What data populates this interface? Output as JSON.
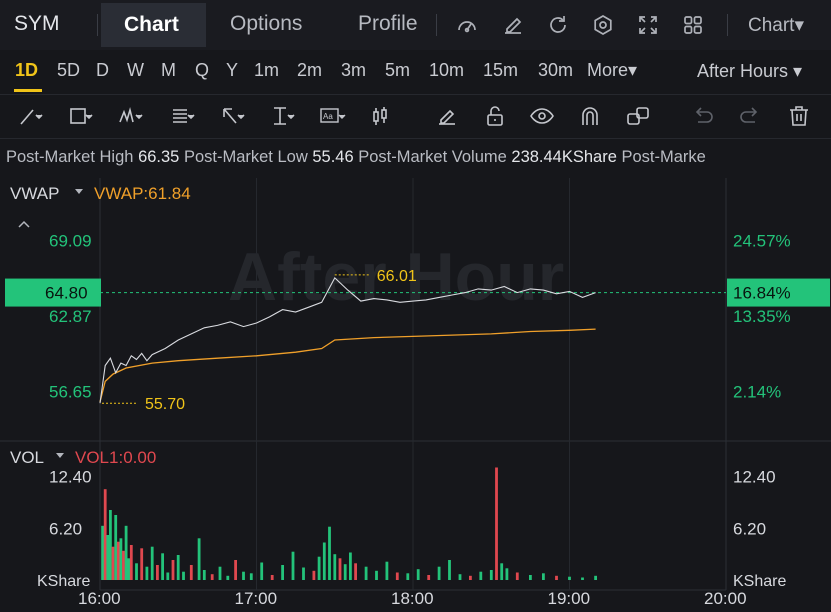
{
  "header": {
    "ticker": "SYM",
    "tabs": [
      "Chart",
      "Options",
      "Profile"
    ],
    "active_tab": "Chart",
    "chart_menu": "Chart▾",
    "icons": [
      "speedometer-icon",
      "edit-icon",
      "refresh-icon",
      "settings-icon",
      "fullscreen-icon",
      "grid-icon"
    ]
  },
  "timeframes": {
    "items": [
      "1D",
      "5D",
      "D",
      "W",
      "M",
      "Q",
      "Y",
      "1m",
      "2m",
      "3m",
      "5m",
      "10m",
      "15m",
      "30m",
      "More▾"
    ],
    "active": "1D",
    "session": "After Hours ▾"
  },
  "drawing_tools": [
    "trend-line-icon",
    "rectangle-icon",
    "pattern-icon",
    "fib-icon",
    "arrow-icon",
    "measure-icon",
    "text-icon",
    "candles-icon",
    "pen-icon",
    "lock-icon",
    "eye-icon",
    "magnet-icon",
    "link-icon",
    "undo-icon",
    "redo-icon",
    "trash-icon"
  ],
  "stats": {
    "high_label": "Post-Market High",
    "high_value": "66.35",
    "low_label": "Post-Market Low",
    "low_value": "55.46",
    "volume_label": "Post-Market Volume",
    "volume_value": "238.44KShare",
    "truncated": "Post-Marke"
  },
  "colors": {
    "up": "#23c37a",
    "down": "#e0484f",
    "vwap": "#f0a02a",
    "price": "#d9dbe0",
    "accent": "#f0c419"
  },
  "chart_data": [
    {
      "type": "line",
      "indicator_label": "VWAP",
      "indicator_value": "VWAP:61.84",
      "watermark": "After Hour",
      "ylim": [
        53.5,
        72.0
      ],
      "left_ticks": [
        "69.09",
        "62.87",
        "56.65"
      ],
      "right_ticks": [
        "24.57%",
        "13.35%",
        "2.14%"
      ],
      "current_price": "64.80",
      "current_change": "16.84%",
      "high_marker": "66.01",
      "low_marker": "55.70",
      "x_ticks": [
        "16:00",
        "17:00",
        "18:00",
        "19:00",
        "20:00"
      ],
      "x_range": [
        "16:00",
        "20:00"
      ],
      "series": [
        {
          "x": [
            "16:00",
            "16:02",
            "16:04",
            "16:06",
            "16:08",
            "16:10",
            "16:12",
            "16:14",
            "16:16",
            "16:18",
            "16:20",
            "16:25",
            "16:30",
            "16:35",
            "16:40",
            "16:45",
            "16:50",
            "16:55",
            "17:00",
            "17:05",
            "17:10",
            "17:15",
            "17:20",
            "17:25",
            "17:30",
            "17:35",
            "17:40",
            "17:45",
            "17:50",
            "17:55",
            "18:00",
            "18:05",
            "18:10",
            "18:15",
            "18:20",
            "18:25",
            "18:30",
            "18:35",
            "18:40",
            "18:45",
            "18:50",
            "18:55",
            "19:00",
            "19:05",
            "19:10"
          ],
          "values": [
            55.7,
            58.8,
            59.4,
            58.2,
            59.0,
            58.8,
            59.6,
            59.3,
            59.8,
            59.2,
            59.7,
            60.2,
            60.9,
            61.4,
            61.9,
            62.1,
            62.4,
            62.0,
            62.3,
            62.8,
            63.4,
            63.2,
            63.6,
            64.0,
            66.01,
            65.0,
            64.1,
            64.3,
            64.2,
            64.0,
            64.1,
            64.2,
            64.4,
            64.6,
            64.8,
            65.1,
            65.0,
            65.3,
            64.8,
            65.1,
            65.0,
            64.7,
            64.9,
            64.4,
            64.8
          ]
        },
        {
          "x": [
            "16:00",
            "16:02",
            "16:05",
            "16:10",
            "16:20",
            "16:30",
            "16:45",
            "17:00",
            "17:15",
            "17:25",
            "17:30",
            "17:45",
            "18:00",
            "18:15",
            "18:30",
            "18:45",
            "19:00",
            "19:10"
          ],
          "values": [
            55.8,
            57.5,
            58.1,
            58.6,
            59.0,
            59.2,
            59.4,
            59.6,
            59.9,
            60.2,
            60.9,
            61.1,
            61.2,
            61.3,
            61.4,
            61.6,
            61.7,
            61.8
          ]
        }
      ]
    },
    {
      "type": "bar",
      "indicator_label": "VOL",
      "indicator_value": "VOL1:0.00",
      "unit": "KShare",
      "ylim": [
        0,
        15
      ],
      "left_ticks": [
        "12.40",
        "6.20"
      ],
      "right_ticks": [
        "12.40",
        "6.20"
      ],
      "x_range": [
        "16:00",
        "20:00"
      ],
      "series": [
        {
          "x": [
            "16:01",
            "16:02",
            "16:03",
            "16:04",
            "16:05",
            "16:06",
            "16:07",
            "16:08",
            "16:09",
            "16:10",
            "16:11",
            "16:12",
            "16:14",
            "16:16",
            "16:18",
            "16:20",
            "16:22",
            "16:24",
            "16:26",
            "16:28",
            "16:30",
            "16:32",
            "16:35",
            "16:38",
            "16:40",
            "16:43",
            "16:46",
            "16:49",
            "16:52",
            "16:55",
            "16:58",
            "17:02",
            "17:06",
            "17:10",
            "17:14",
            "17:18",
            "17:22",
            "17:24",
            "17:26",
            "17:28",
            "17:30",
            "17:32",
            "17:34",
            "17:36",
            "17:38",
            "17:42",
            "17:46",
            "17:50",
            "17:54",
            "17:58",
            "18:02",
            "18:06",
            "18:10",
            "18:14",
            "18:18",
            "18:22",
            "18:26",
            "18:30",
            "18:32",
            "18:34",
            "18:36",
            "18:40",
            "18:45",
            "18:50",
            "18:55",
            "19:00",
            "19:05",
            "19:10"
          ],
          "values": [
            6.5,
            10.9,
            5.4,
            8.4,
            4.0,
            7.8,
            4.6,
            5.0,
            3.5,
            6.5,
            2.6,
            4.2,
            2.0,
            3.8,
            1.6,
            4.0,
            1.8,
            3.2,
            0.9,
            2.4,
            3.0,
            1.0,
            1.8,
            5.0,
            1.2,
            0.7,
            1.6,
            0.5,
            2.4,
            1.0,
            0.8,
            2.1,
            0.6,
            1.8,
            3.4,
            1.5,
            1.1,
            2.8,
            4.5,
            6.4,
            3.1,
            2.6,
            1.9,
            3.3,
            2.0,
            1.6,
            1.1,
            2.2,
            0.9,
            0.8,
            1.3,
            0.6,
            1.6,
            2.4,
            0.7,
            0.5,
            1.0,
            1.2,
            13.5,
            2.0,
            1.4,
            0.9,
            0.6,
            0.8,
            0.5,
            0.4,
            0.3,
            0.5
          ],
          "down": [
            0,
            1,
            0,
            0,
            1,
            0,
            1,
            0,
            1,
            0,
            0,
            1,
            0,
            1,
            0,
            0,
            1,
            0,
            0,
            1,
            0,
            0,
            1,
            0,
            0,
            1,
            0,
            0,
            1,
            0,
            0,
            0,
            1,
            0,
            0,
            0,
            1,
            0,
            0,
            0,
            0,
            1,
            0,
            0,
            1,
            0,
            0,
            0,
            1,
            0,
            0,
            1,
            0,
            0,
            0,
            1,
            0,
            0,
            1,
            0,
            0,
            1,
            0,
            0,
            1,
            0,
            0,
            0
          ]
        }
      ]
    }
  ]
}
